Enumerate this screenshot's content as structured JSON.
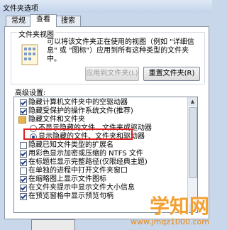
{
  "window": {
    "title": "文件夹选项"
  },
  "tabs": [
    {
      "label": "常规",
      "active": false
    },
    {
      "label": "查看",
      "active": true
    },
    {
      "label": "搜索",
      "active": false
    }
  ],
  "folder_view": {
    "title": "文件夹视图",
    "description": "可以将该文件夹正在使用的视图（例如 \"详细信息\" 或 \"图标\"）应用到所有这种类型的文件夹中。",
    "apply_button": "应用到文件夹(L)",
    "reset_button": "重置文件夹(R)"
  },
  "advanced": {
    "label": "高级设置:",
    "items": [
      {
        "type": "checkbox",
        "checked": true,
        "label": "隐藏计算机文件夹中的空驱动器",
        "indent": 0
      },
      {
        "type": "checkbox",
        "checked": true,
        "label": "隐藏受保护的操作系统文件(推荐)",
        "indent": 0
      },
      {
        "type": "folder",
        "label": "隐藏文件和文件夹",
        "indent": 0
      },
      {
        "type": "radio",
        "checked": false,
        "label": "不显示隐藏的文件、文件夹或驱动器",
        "indent": 1
      },
      {
        "type": "radio",
        "checked": true,
        "label": "显示隐藏的文件、文件夹和驱动器",
        "indent": 1
      },
      {
        "type": "checkbox",
        "checked": false,
        "label": "隐藏已知文件类型的扩展名",
        "indent": 0,
        "highlighted": true
      },
      {
        "type": "checkbox",
        "checked": true,
        "label": "用彩色显示加密或压缩的 NTFS 文件",
        "indent": 0
      },
      {
        "type": "checkbox",
        "checked": true,
        "label": "在标题栏显示完整路径(仅限经典主题)",
        "indent": 0
      },
      {
        "type": "checkbox",
        "checked": false,
        "label": "在单独的进程中打开文件夹窗口",
        "indent": 0
      },
      {
        "type": "checkbox",
        "checked": true,
        "label": "在缩略图上显示文件图标",
        "indent": 0
      },
      {
        "type": "checkbox",
        "checked": true,
        "label": "在文件夹提示中显示文件大小信息",
        "indent": 0
      },
      {
        "type": "checkbox",
        "checked": true,
        "label": "在预览窗格中显示预览句柄",
        "indent": 0
      }
    ]
  },
  "watermark": {
    "brand": "学知网",
    "url": "www.jmqz1000.com"
  }
}
